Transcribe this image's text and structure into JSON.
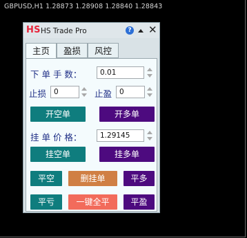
{
  "chart": {
    "quote_line": "GBPUSD,H1  1.28873 1.28908 1.28840 1.28843"
  },
  "panel": {
    "logo": "HS",
    "title": "HS Trade Pro",
    "help_glyph": "?",
    "close_glyph": "✕",
    "tabs": [
      {
        "label": "主页",
        "active": true
      },
      {
        "label": "盈损",
        "active": false
      },
      {
        "label": "风控",
        "active": false
      }
    ],
    "order": {
      "lot_label": "下 单 手 数：",
      "lot_value": "0.01",
      "stoploss_label": "止损",
      "stoploss_value": "0",
      "takeprofit_label": "止盈",
      "takeprofit_value": "0",
      "open_short_label": "开空单",
      "open_long_label": "开多单"
    },
    "pending": {
      "price_label": "挂 单 价 格：",
      "price_value": "1.29145",
      "pending_short_label": "挂空单",
      "pending_long_label": "挂多单"
    },
    "actions": {
      "close_short_label": "平空",
      "delete_pending_label": "删挂单",
      "close_long_label": "平多",
      "close_loss_label": "平亏",
      "close_all_label": "一键全平",
      "close_profit_label": "平盈"
    },
    "colors": {
      "teal": "#0f7d7e",
      "purple": "#4d0a7f",
      "orange": "#d07f44",
      "salmon": "#f26b5b",
      "label_blue": "#1f2f86",
      "logo_red": "#e8243a"
    }
  }
}
